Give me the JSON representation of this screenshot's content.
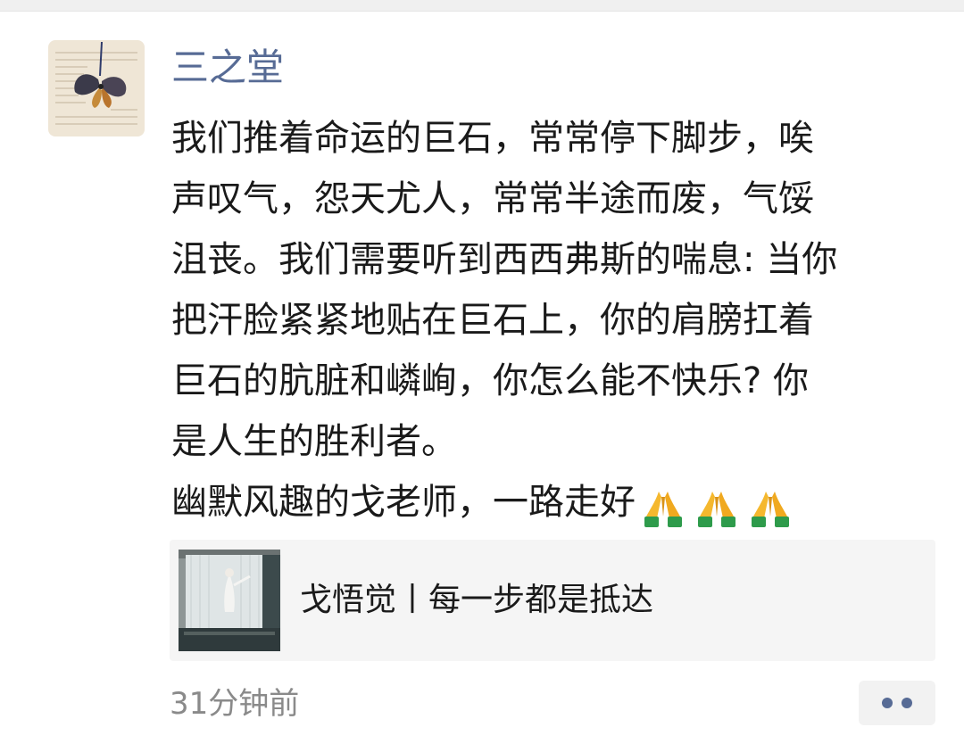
{
  "post": {
    "author": "三之堂",
    "avatar_icon": "book-with-butterfly-avatar",
    "text_paragraphs": [
      "我们推着命运的巨石，常常停下脚步，唉\n声叹气，怨天尤人，常常半途而废，气馁\n沮丧。我们需要听到西西弗斯的喘息: 当你\n把汗脸紧紧地贴在巨石上，你的肩膀扛着\n巨石的肮脏和嶙峋，你怎么能不快乐? 你\n是人生的胜利者。",
      "幽默风趣的戈老师，一路走好"
    ],
    "emojis": [
      "folded-hands-emoji",
      "folded-hands-emoji",
      "folded-hands-emoji"
    ],
    "link_card": {
      "thumbnail_icon": "dancer-by-window-thumbnail",
      "title": "戈悟觉丨每一步都是抵达"
    },
    "timestamp": "31分钟前",
    "more_icon": "more-dots-icon"
  },
  "colors": {
    "author_name": "#576b95",
    "body_text": "#1a1a1a",
    "timestamp": "#8a8a8a",
    "card_bg": "#f5f5f5"
  }
}
